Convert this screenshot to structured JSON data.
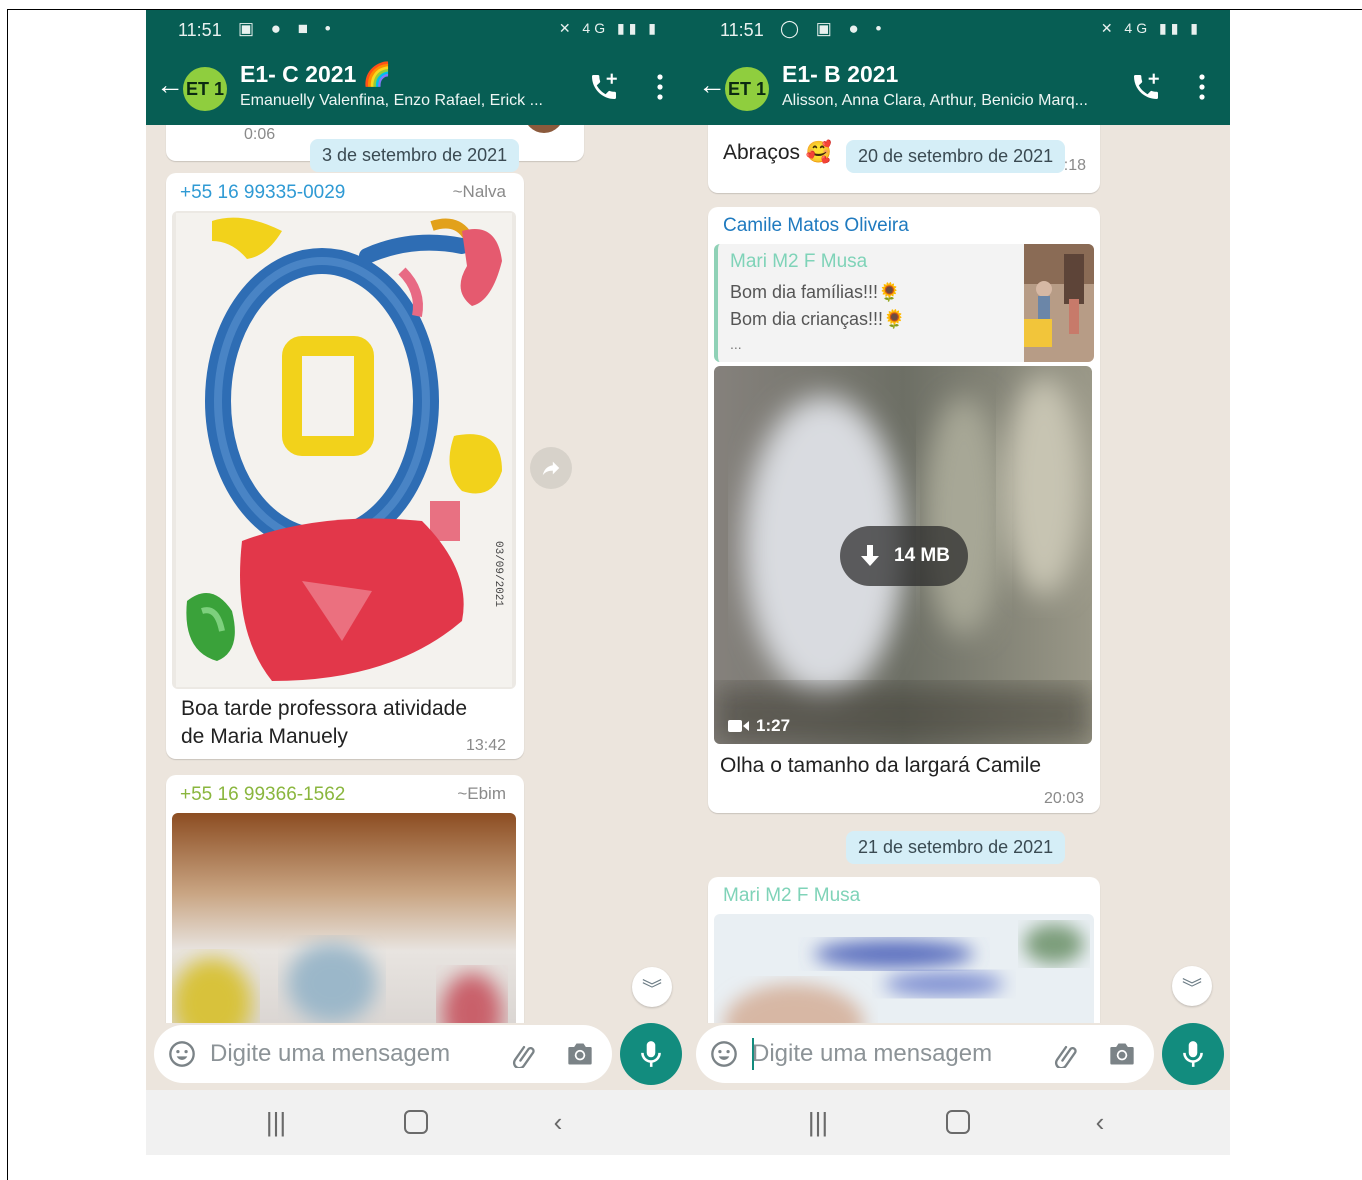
{
  "left": {
    "status_time": "11:51",
    "chat_title": "E1- C 2021",
    "title_emoji": "🌈",
    "participants": "Emanuelly Valenfina, Enzo Rafael, Erick ...",
    "avatar_label": "ET 1",
    "prev_duration": "0:06",
    "date_chip": "3 de setembro de 2021",
    "msg1": {
      "sender": "+55 16 99335-0029",
      "alias": "~Nalva",
      "caption_line1": "Boa tarde professora atividade",
      "caption_line2": "de  Maria Manuely",
      "time": "13:42",
      "drawing_date": "03/09/2021"
    },
    "msg2": {
      "sender": "+55 16 99366-1562",
      "alias": "~Ebim"
    },
    "input_placeholder": "Digite uma mensagem"
  },
  "right": {
    "status_time": "11:51",
    "chat_title": "E1- B 2021",
    "participants": "Alisson, Anna Clara, Arthur, Benicio Marq...",
    "avatar_label": "ET 1",
    "prev_text": "Abraços",
    "prev_emoji": "🥰",
    "prev_time": "09:18",
    "date_chip1": "20 de setembro de 2021",
    "msg1": {
      "sender": "Camile Matos Oliveira",
      "reply_author": "Mari M2 F Musa",
      "reply_line1": "Bom dia famílias!!!🌻",
      "reply_line2": "Bom dia crianças!!!🌻",
      "reply_more": "...",
      "video_size": "14 MB",
      "video_duration": "1:27",
      "caption": "Olha o tamanho da largará Camile",
      "time": "20:03"
    },
    "date_chip2": "21 de setembro de 2021",
    "msg2": {
      "sender": "Mari M2 F Musa"
    },
    "input_placeholder": "Digite uma mensagem"
  },
  "colors": {
    "header": "#075e54",
    "accent": "#128c7e",
    "chat_bg": "#ece5dd",
    "sender_blue": "#1f7abf",
    "sender_green": "#8ab63e",
    "sender_teal": "#7fd3b8"
  },
  "icons": [
    "back-arrow-icon",
    "add-call-icon",
    "more-options-icon",
    "emoji-icon",
    "attach-icon",
    "camera-icon",
    "mic-icon",
    "forward-icon",
    "scroll-down-icon",
    "download-icon",
    "video-camera-icon",
    "recent-apps-icon",
    "home-icon",
    "back-nav-icon"
  ]
}
